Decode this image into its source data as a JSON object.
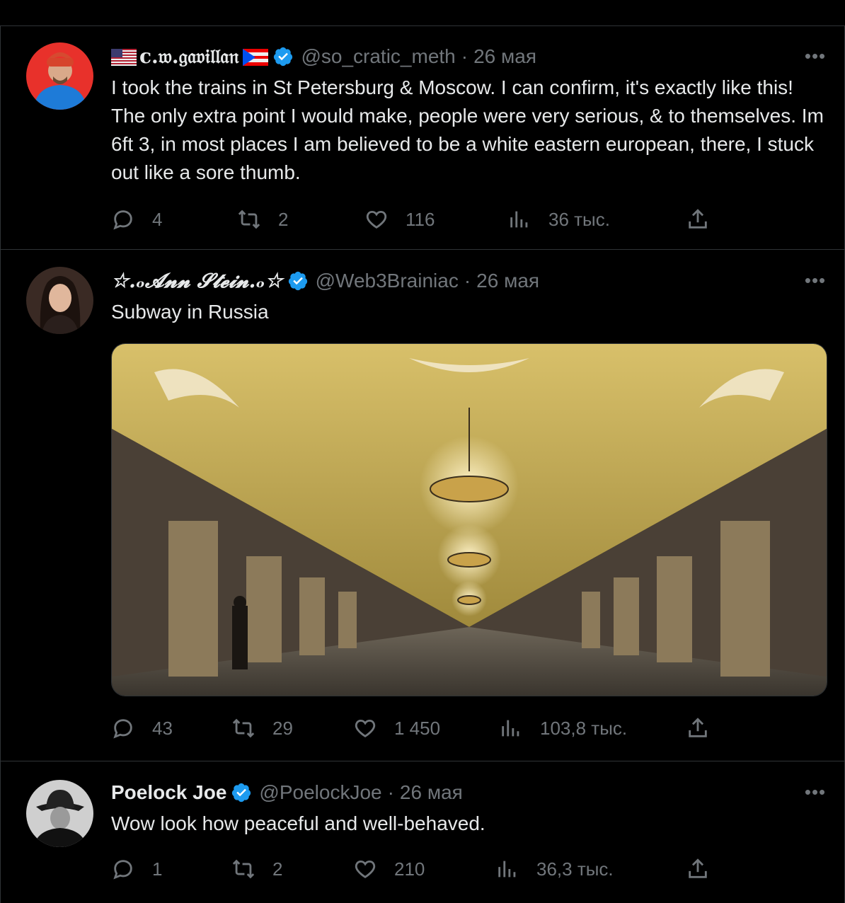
{
  "tweets": [
    {
      "author": {
        "display_name": "c.𝔴.𝔤𝔞𝔳𝔦𝔩𝔩𝔞𝔫",
        "handle": "@so_cratic_meth",
        "date": "26 мая"
      },
      "text": "I took the trains in St Petersburg & Moscow. I can confirm, it's exactly like this! The only extra point I would make, people were very serious, & to themselves. Im 6ft 3, in most places I am believed to be a white eastern european, there, I stuck out like a sore thumb.",
      "stats": {
        "replies": "4",
        "reposts": "2",
        "likes": "116",
        "views": "36 тыс."
      }
    },
    {
      "author": {
        "display_name": "☆.ₒ𝓐𝓷𝓷 𝓢𝓽𝓮𝓲𝓷.ₒ☆",
        "handle": "@Web3Brainiac",
        "date": "26 мая"
      },
      "text": "Subway in Russia",
      "stats": {
        "replies": "43",
        "reposts": "29",
        "likes": "1 450",
        "views": "103,8 тыс."
      }
    },
    {
      "author": {
        "display_name": "Poelock Joe",
        "handle": "@PoelockJoe",
        "date": "26 мая"
      },
      "text": "Wow look how peaceful and well-behaved.",
      "stats": {
        "replies": "1",
        "reposts": "2",
        "likes": "210",
        "views": "36,3 тыс."
      }
    }
  ],
  "colors": {
    "background": "#000000",
    "text": "#e7e9ea",
    "muted": "#71767b",
    "verified": "#1d9bf0",
    "border": "#2f3336"
  },
  "icons": [
    "verified-badge-icon",
    "more-icon",
    "reply-icon",
    "repost-icon",
    "like-icon",
    "views-icon",
    "share-icon"
  ]
}
